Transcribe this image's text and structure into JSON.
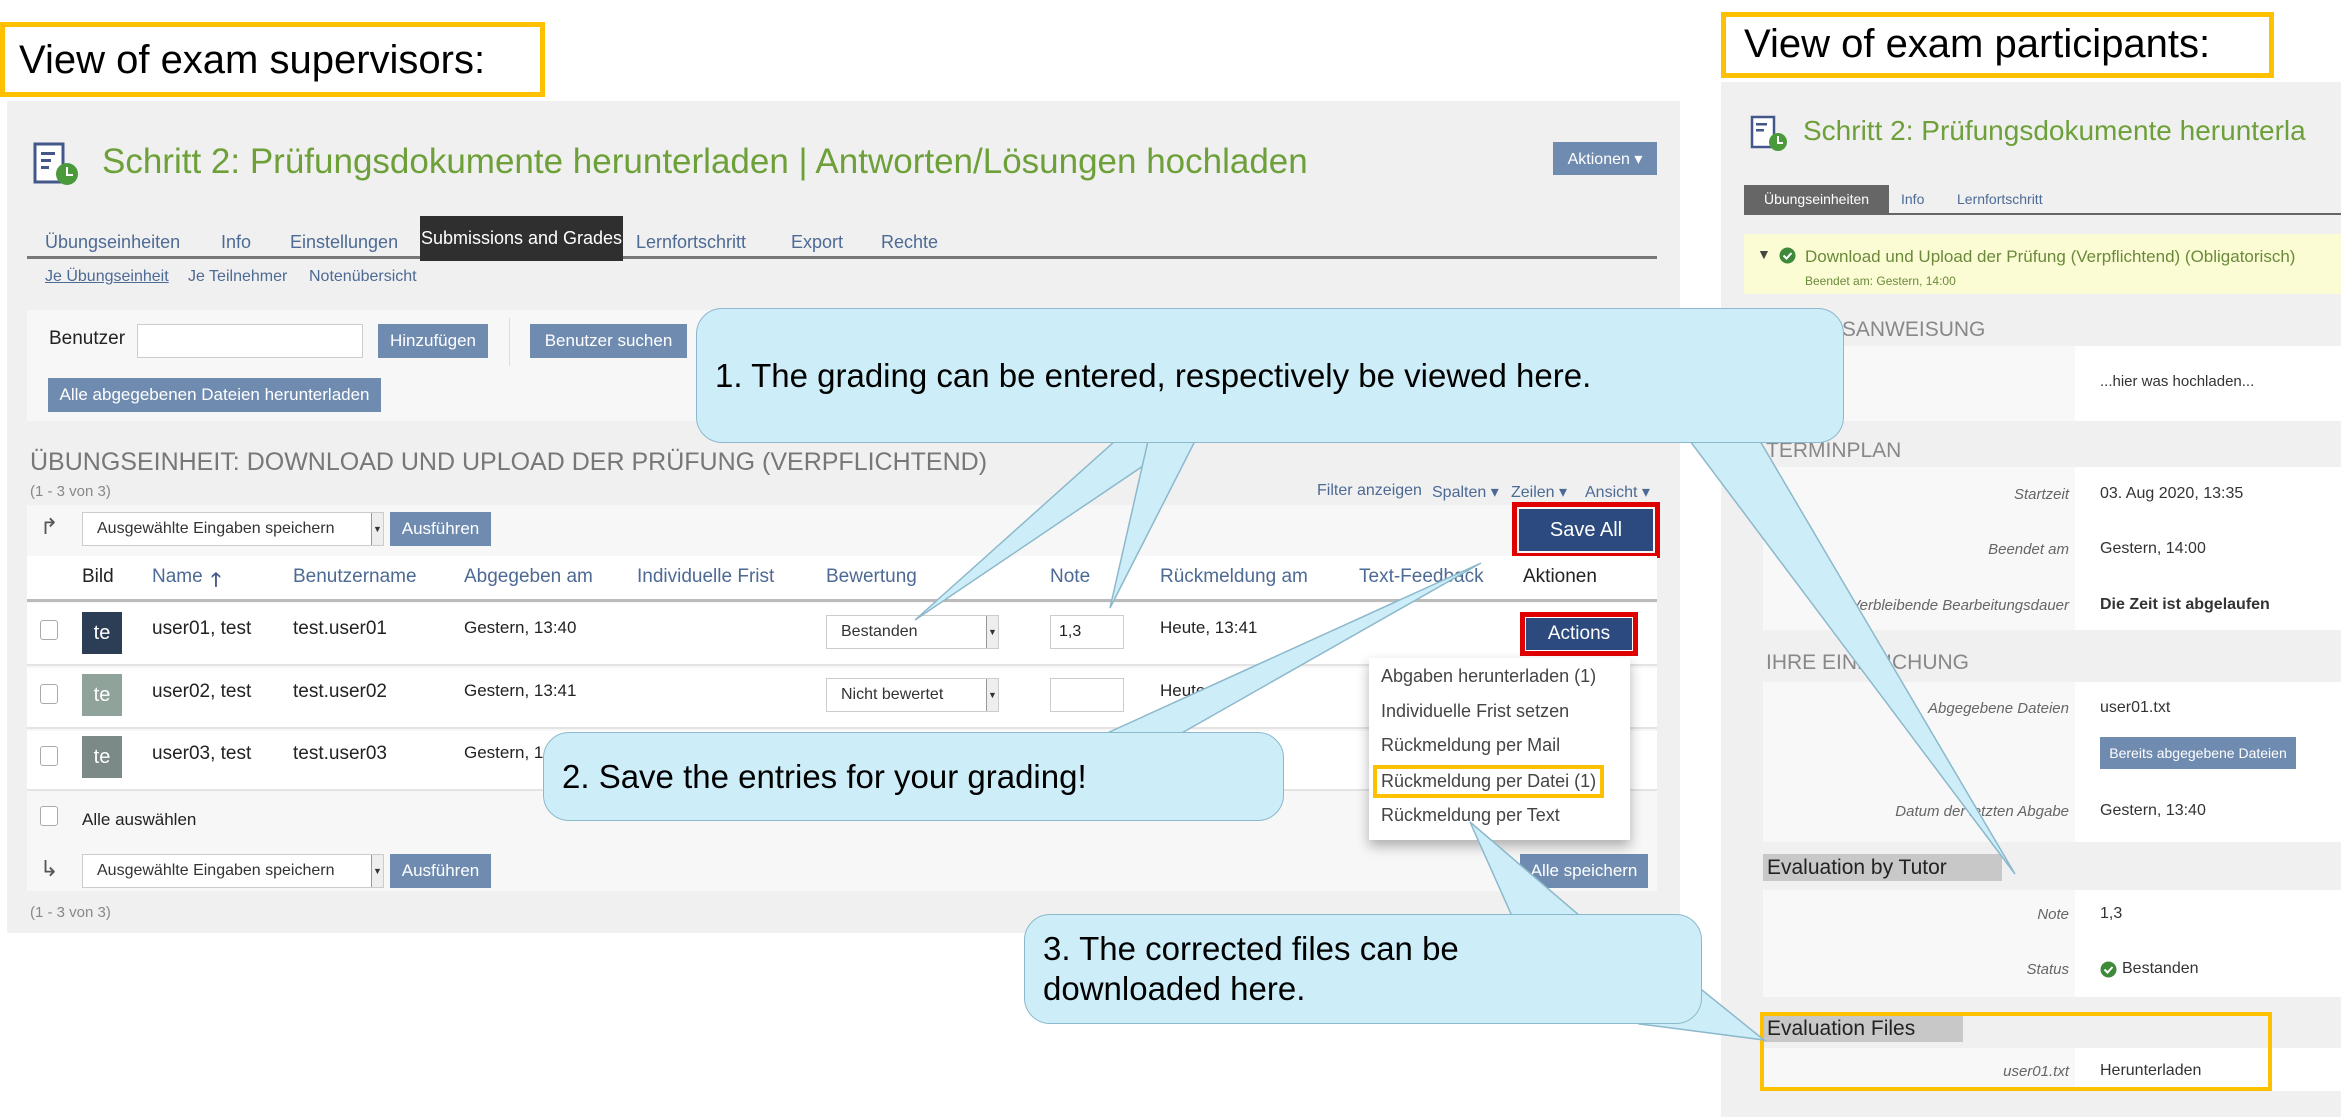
{
  "labels": {
    "supervisors": "View of exam supervisors:",
    "participants": "View of exam participants:"
  },
  "colors": {
    "title_green": "#6ea03a",
    "button_blue": "#6f8bb0",
    "save_blue": "#2c4a7e",
    "highlight_red": "#e00000",
    "highlight_orange": "#ffc000",
    "callout_fill": "#cdeef8"
  },
  "supervisor": {
    "title": "Schritt 2: Prüfungsdokumente herunterladen | Antworten/Lösungen hochladen",
    "aktionen": "Aktionen ▾",
    "tabs": [
      "Übungseinheiten",
      "Info",
      "Einstellungen",
      "Submissions and Grades",
      "Lernfortschritt",
      "Export",
      "Rechte"
    ],
    "active_tab": "Submissions and Grades",
    "subtabs": [
      "Je Übungseinheit",
      "Je Teilnehmer",
      "Notenübersicht"
    ],
    "filter": {
      "user_label": "Benutzer",
      "user_value": "",
      "add": "Hinzufügen",
      "search": "Benutzer suchen",
      "download_all": "Alle abgegebenen Dateien herunterladen"
    },
    "section_title": "ÜBUNGSEINHEIT: DOWNLOAD UND UPLOAD DER PRÜFUNG (VERPFLICHTEND)",
    "count": "(1 - 3 von 3)",
    "table_controls": [
      "Filter anzeigen",
      "Spalten ▾",
      "Zeilen ▾",
      "Ansicht ▾"
    ],
    "bulk_select": "Ausgewählte Eingaben speichern",
    "execute": "Ausführen",
    "save_all": "Save All",
    "save_all_bottom": "Alle speichern",
    "select_all": "Alle auswählen",
    "columns": [
      "Bild",
      "Name",
      "Benutzername",
      "Abgegeben am",
      "Individuelle Frist",
      "Bewertung",
      "Note",
      "Rückmeldung am",
      "Text-Feedback",
      "Aktionen"
    ],
    "sort_icon": "arrow-up-icon",
    "rows": [
      {
        "avatar": "te",
        "name": "user01, test",
        "username": "test.user01",
        "submitted": "Gestern, 13:40",
        "grading": "Bestanden",
        "note": "1,3",
        "feedback_at": "Heute, 13:41",
        "action": "Actions"
      },
      {
        "avatar": "te",
        "name": "user02, test",
        "username": "test.user02",
        "submitted": "Gestern, 13:41",
        "grading": "Nicht bewertet",
        "note": "",
        "feedback_at": "Heute"
      },
      {
        "avatar": "te",
        "name": "user03, test",
        "username": "test.user03",
        "submitted": "Gestern, 1"
      }
    ],
    "action_menu": [
      "Abgaben herunterladen (1)",
      "Individuelle Frist setzen",
      "Rückmeldung per Mail",
      "Rückmeldung per Datei (1)",
      "Rückmeldung per Text"
    ]
  },
  "callouts": [
    "1. The grading can be entered, respectively be viewed here.",
    "2. Save the entries for your grading!",
    "3. The corrected files can be downloaded here."
  ],
  "participant": {
    "title": "Schritt 2: Prüfungsdokumente herunterla",
    "tabs": [
      "Übungseinheiten",
      "Info",
      "Lernfortschritt"
    ],
    "unit_title": "Download und Upload der Prüfung (Verpflichtend) (Obligatorisch)",
    "unit_sub": "Beendet am: Gestern, 14:00",
    "instructions_heading": "ARBEITSANWEISUNG",
    "instructions": "...hier was hochladen...",
    "schedule_heading": "TERMINPLAN",
    "start_label": "Startzeit",
    "start": "03. Aug 2020, 13:35",
    "end_label": "Beendet am",
    "end": "Gestern, 14:00",
    "remaining_label": "Verbleibende Bearbeitungsdauer",
    "remaining": "Die Zeit ist abgelaufen",
    "submission_heading": "IHRE EINREICHUNG",
    "files_label": "Abgegebene Dateien",
    "files": "user01.txt",
    "files_button": "Bereits abgegebene Dateien",
    "last_label": "Datum der letzten Abgabe",
    "last": "Gestern, 13:40",
    "eval_heading": "Evaluation by Tutor",
    "note_label": "Note",
    "note": "1,3",
    "status_label": "Status",
    "status": "Bestanden",
    "files_heading": "Evaluation Files",
    "eval_file": "user01.txt",
    "download": "Herunterladen"
  }
}
